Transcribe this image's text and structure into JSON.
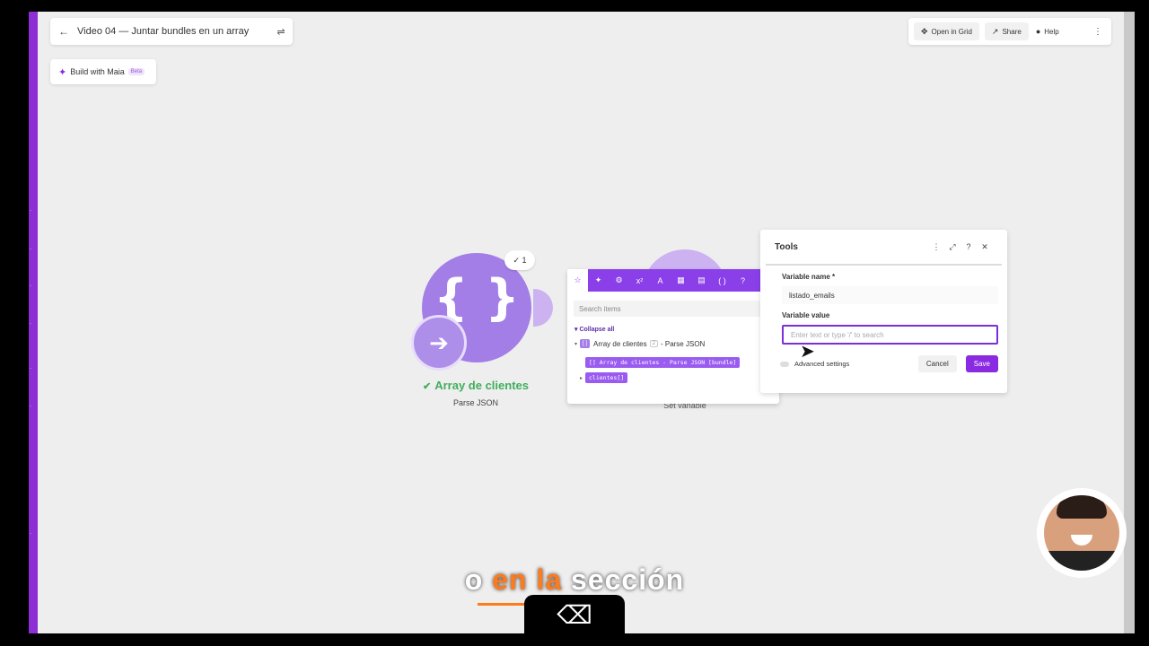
{
  "header": {
    "back_icon": "←",
    "title": "Video 04 — Juntar bundles en un array",
    "settings_icon": "⇌"
  },
  "maia": {
    "label": "Build with Maia",
    "beta": "Beta"
  },
  "top_actions": {
    "open_grid": "Open in Grid",
    "share": "Share",
    "help": "Help",
    "more": "⋮"
  },
  "module": {
    "braces": "{ }",
    "counter": "✓ 1",
    "name": "Array de clientes",
    "type": "Parse JSON"
  },
  "set_variable": {
    "type": "Set variable"
  },
  "mapper": {
    "search_placeholder": "Search items",
    "collapse_all": "Collapse all",
    "tree_item_name": "Array de clientes",
    "tree_item_num": "2",
    "tree_item_source": "- Parse JSON",
    "pill_bundle": "[] Array de clientes - Parse JSON [bundle]",
    "pill_clientes": "clientes[]",
    "tabs": [
      "☆",
      "✦",
      "⚙",
      "x²",
      "A",
      "▦",
      "▤",
      "( )",
      "?"
    ],
    "close": "✕"
  },
  "tools": {
    "title": "Tools",
    "var_name_label": "Variable name *",
    "var_name_value": "listado_emails",
    "var_value_label": "Variable value",
    "var_value_placeholder": "Enter text or type '/' to search",
    "advanced": "Advanced settings",
    "cancel": "Cancel",
    "save": "Save"
  },
  "caption": {
    "word1": "o",
    "word2": "en la",
    "word3": "sección"
  },
  "colors": {
    "accent": "#8a2be2",
    "module": "#a27ee6",
    "success": "#3fae5c",
    "caption_highlight": "#ff7a1a"
  }
}
